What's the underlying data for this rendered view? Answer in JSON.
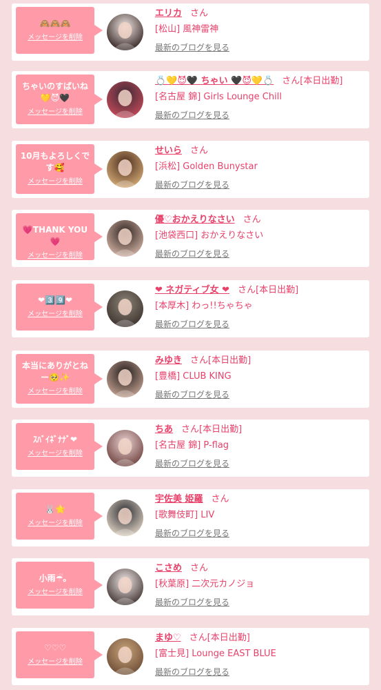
{
  "common": {
    "delete_label": "メッセージを削除",
    "blog_label": "最新のブログを見る",
    "suffix_san": "さん"
  },
  "colors": {
    "page_bg": "#f6dde0",
    "bubble": "#ff9aa8",
    "accent": "#e8416a",
    "link_gray": "#777777"
  },
  "items": [
    {
      "message": "🙈🙈🙈",
      "name": "エリカ",
      "status": "",
      "shop": "[松山] 風神雷神",
      "avatar_tone": [
        "#f1e7e4",
        "#2b1b18"
      ]
    },
    {
      "message": "ちゃいのすばいね💛😈🖤",
      "name": "💍💛😈🖤 ちゃい 🖤😈💛💍",
      "status": "[本日出勤]",
      "shop": "[名古屋 錦] Girls Lounge Chill",
      "avatar_tone": [
        "#3a2a35",
        "#c94a5a"
      ]
    },
    {
      "message": "10月もよろしくです🥰",
      "name": "せいら",
      "status": "",
      "shop": "[浜松] Golden Bunystar",
      "avatar_tone": [
        "#4a2b1c",
        "#d9b07a"
      ]
    },
    {
      "message": "💗THANK YOU💗",
      "name": "優♡おかえりなさい",
      "status": "",
      "shop": "[池袋西口] おかえりなさい",
      "avatar_tone": [
        "#2d2220",
        "#d8b7a8"
      ]
    },
    {
      "message": "❤3️⃣9️⃣❤",
      "name": "❤ ネガティブ女 ❤",
      "status": "[本日出勤]",
      "shop": "[本厚木] わっ!!ちゃちゃ",
      "avatar_tone": [
        "#8b8477",
        "#3a302b"
      ]
    },
    {
      "message": "本当にありがとねー🥺✨",
      "name": "みゆき",
      "status": "[本日出勤]",
      "shop": "[豊橋] CLUB KING",
      "avatar_tone": [
        "#1f1a1a",
        "#c9a695"
      ]
    },
    {
      "message": "ｽﾊﾞｲﾈﾞﾅﾅﾞ❤",
      "name": "ちあ",
      "status": "[本日出勤]",
      "shop": "[名古屋 錦] P-flag",
      "avatar_tone": [
        "#e9d0d2",
        "#6b3f3a"
      ]
    },
    {
      "message": "🐰🌟",
      "name": "宇佐美 姫羅",
      "status": "",
      "shop": "[歌舞伎町] LIV",
      "avatar_tone": [
        "#2b2d33",
        "#e6d8c8"
      ]
    },
    {
      "message": "小雨☔。",
      "name": "こさめ",
      "status": "",
      "shop": "[秋葉原] 二次元カノジョ",
      "avatar_tone": [
        "#efe7e6",
        "#3b2e2c"
      ]
    },
    {
      "message": "♡♡♡",
      "name": "まゆ♡",
      "status": "[本日出勤]",
      "shop": "[富士見] Lounge EAST BLUE",
      "avatar_tone": [
        "#c9a47a",
        "#6a4a34"
      ]
    }
  ]
}
